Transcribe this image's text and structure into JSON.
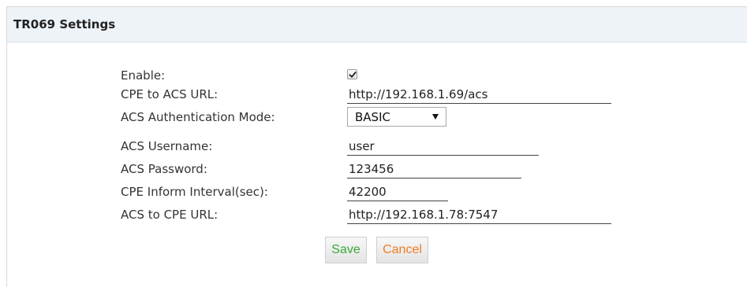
{
  "panel": {
    "title": "TR069 Settings"
  },
  "form": {
    "enable": {
      "label": "Enable:",
      "checked": true
    },
    "cpe_to_acs_url": {
      "label": "CPE to ACS URL:",
      "value": "http://192.168.1.69/acs"
    },
    "acs_auth_mode": {
      "label": "ACS Authentication Mode:",
      "value": "BASIC"
    },
    "acs_username": {
      "label": "ACS Username:",
      "value": "user"
    },
    "acs_password": {
      "label": "ACS Password:",
      "value": "123456"
    },
    "cpe_inform_interval": {
      "label": "CPE Inform Interval(sec):",
      "value": "42200"
    },
    "acs_to_cpe_url": {
      "label": "ACS to CPE URL:",
      "value": "http://192.168.1.78:7547"
    }
  },
  "buttons": {
    "save_label": "Save",
    "cancel_label": "Cancel"
  },
  "colors": {
    "header_bg": "#eef3f8",
    "save_text": "#3aa83a",
    "cancel_text": "#f07b22"
  }
}
